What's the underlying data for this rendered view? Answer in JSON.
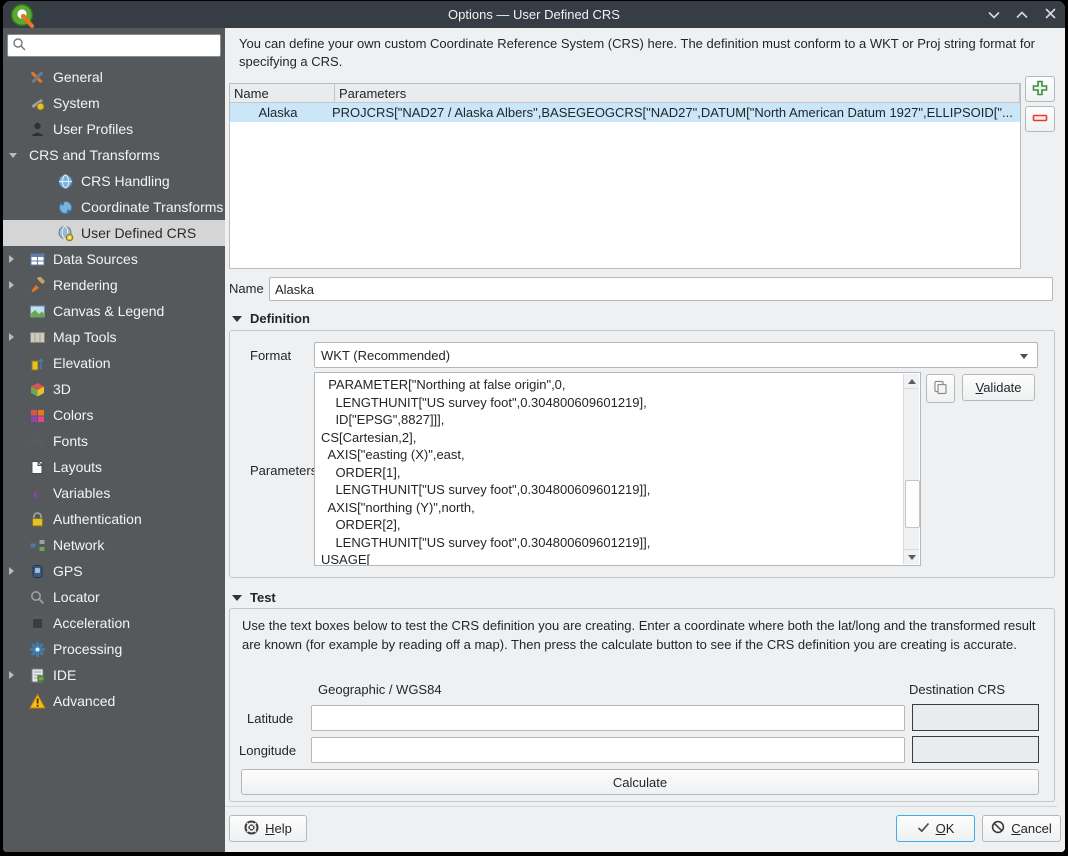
{
  "window": {
    "title": "Options — User Defined CRS"
  },
  "titlebar_icons": {
    "minimize": "chevron-down-icon",
    "maximize": "chevron-up-icon",
    "close": "close-icon"
  },
  "sidebar": {
    "search_value": "",
    "items": [
      {
        "id": "general",
        "label": "General",
        "icon": "wrench-hammer"
      },
      {
        "id": "system",
        "label": "System",
        "icon": "system-gear"
      },
      {
        "id": "user-profiles",
        "label": "User Profiles",
        "icon": "user"
      },
      {
        "id": "crs-and-transforms",
        "label": "CRS and Transforms",
        "expander": "expanded"
      },
      {
        "id": "crs-handling",
        "label": "CRS Handling",
        "icon": "globe",
        "child": true
      },
      {
        "id": "coordinate-transforms",
        "label": "Coordinate Transforms",
        "icon": "globe-arrows",
        "child": true
      },
      {
        "id": "user-defined-crs",
        "label": "User Defined CRS",
        "icon": "globe-gear",
        "child": true,
        "selected": true
      },
      {
        "id": "data-sources",
        "label": "Data Sources",
        "icon": "table-grid",
        "expander": "collapsed"
      },
      {
        "id": "rendering",
        "label": "Rendering",
        "icon": "paintbrush",
        "expander": "collapsed"
      },
      {
        "id": "canvas-legend",
        "label": "Canvas & Legend",
        "icon": "canvas"
      },
      {
        "id": "map-tools",
        "label": "Map Tools",
        "icon": "map",
        "expander": "collapsed"
      },
      {
        "id": "elevation",
        "label": "Elevation",
        "icon": "elevation"
      },
      {
        "id": "3d",
        "label": "3D",
        "icon": "cube-3d"
      },
      {
        "id": "colors",
        "label": "Colors",
        "icon": "color-swatches"
      },
      {
        "id": "fonts",
        "label": "Fonts",
        "icon": "fonts-aa"
      },
      {
        "id": "layouts",
        "label": "Layouts",
        "icon": "layout-page"
      },
      {
        "id": "variables",
        "label": "Variables",
        "icon": "epsilon"
      },
      {
        "id": "authentication",
        "label": "Authentication",
        "icon": "padlock"
      },
      {
        "id": "network",
        "label": "Network",
        "icon": "network-nodes"
      },
      {
        "id": "gps",
        "label": "GPS",
        "icon": "gps-device",
        "expander": "collapsed"
      },
      {
        "id": "locator",
        "label": "Locator",
        "icon": "magnifier"
      },
      {
        "id": "acceleration",
        "label": "Acceleration",
        "icon": "chip"
      },
      {
        "id": "processing",
        "label": "Processing",
        "icon": "gear-blue"
      },
      {
        "id": "ide",
        "label": "IDE",
        "icon": "script",
        "expander": "collapsed"
      },
      {
        "id": "advanced",
        "label": "Advanced",
        "icon": "warning-triangle"
      }
    ]
  },
  "intro": "You can define your own custom Coordinate Reference System (CRS) here. The definition must conform to a WKT or Proj string format for specifying a CRS.",
  "crs_table": {
    "columns": [
      "Name",
      "Parameters"
    ],
    "rows": [
      {
        "name": "Alaska",
        "parameters": "PROJCRS[\"NAD27 / Alaska Albers\",BASEGEOGCRS[\"NAD27\",DATUM[\"North American Datum 1927\",ELLIPSOID[\"..."
      }
    ]
  },
  "name_field": {
    "label": "Name",
    "value": "Alaska"
  },
  "definition": {
    "title": "Definition",
    "format_label": "Format",
    "format_value": "WKT (Recommended)",
    "parameters_label": "Parameters",
    "validate_label": "Validate",
    "wkt_lines": [
      "  PARAMETER[\"Northing at false origin\",0,",
      "    LENGTHUNIT[\"US survey foot\",0.304800609601219],",
      "    ID[\"EPSG\",8827]]],",
      "CS[Cartesian,2],",
      "  AXIS[\"easting (X)\",east,",
      "    ORDER[1],",
      "    LENGTHUNIT[\"US survey foot\",0.304800609601219]],",
      "  AXIS[\"northing (Y)\",north,",
      "    ORDER[2],",
      "    LENGTHUNIT[\"US survey foot\",0.304800609601219]],",
      "USAGE["
    ]
  },
  "test": {
    "title": "Test",
    "description": "Use the text boxes below to test the CRS definition you are creating. Enter a coordinate where both the lat/long and the transformed result are known (for example by reading off a map). Then press the calculate button to see if the CRS definition you are creating is accurate.",
    "geographic_label": "Geographic / WGS84",
    "destination_label": "Destination CRS",
    "latitude_label": "Latitude",
    "longitude_label": "Longitude",
    "latitude_value": "",
    "longitude_value": "",
    "calculate_label": "Calculate"
  },
  "footer": {
    "help_label": "Help",
    "ok_label": "OK",
    "cancel_label": "Cancel"
  },
  "colors": {
    "accent": "#3daee9",
    "selection_row": "#cbe6f8",
    "titlebar": "#373d44",
    "sidebar": "#55595c",
    "add_icon": "#3e8e41",
    "remove_icon": "#e03c31"
  }
}
